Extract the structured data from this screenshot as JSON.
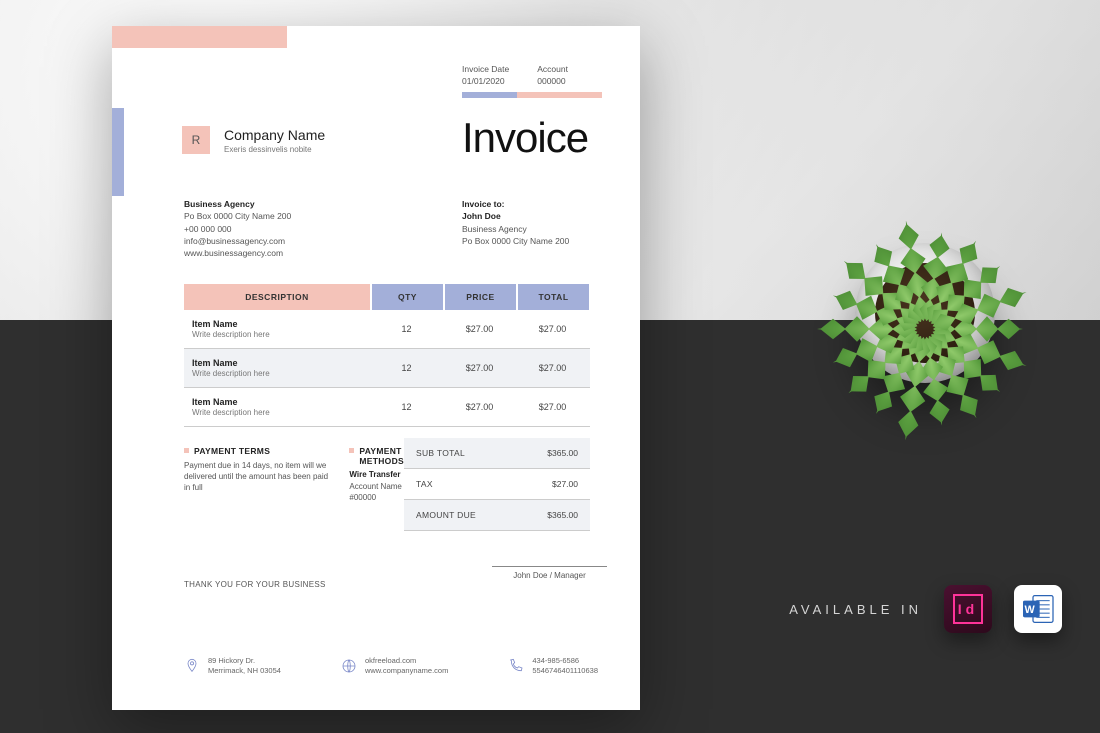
{
  "meta": {
    "date_label": "Invoice Date",
    "date_value": "01/01/2020",
    "account_label": "Account",
    "account_value": "000000"
  },
  "logo_letter": "R",
  "company": {
    "name": "Company Name",
    "tagline": "Exeris dessinvelis nobite"
  },
  "title": "Invoice",
  "from": {
    "name": "Business Agency",
    "line1": "Po Box 0000 City Name 200",
    "phone": "+00 000 000",
    "email": "info@businessagency.com",
    "web": "www.businessagency.com"
  },
  "to": {
    "label": "Invoice to:",
    "name": "John Doe",
    "company": "Business Agency",
    "address": "Po Box 0000 City Name 200"
  },
  "table": {
    "headers": {
      "desc": "DESCRIPTION",
      "qty": "QTY",
      "price": "PRICE",
      "total": "TOTAL"
    },
    "rows": [
      {
        "name": "Item Name",
        "desc": "Write description here",
        "qty": "12",
        "price": "$27.00",
        "total": "$27.00"
      },
      {
        "name": "Item Name",
        "desc": "Write description here",
        "qty": "12",
        "price": "$27.00",
        "total": "$27.00"
      },
      {
        "name": "Item Name",
        "desc": "Write description here",
        "qty": "12",
        "price": "$27.00",
        "total": "$27.00"
      }
    ]
  },
  "payment_terms": {
    "heading": "PAYMENT TERMS",
    "body": "Payment due in 14 days, no item will we delivered until the amount has been paid in full"
  },
  "payment_methods": {
    "heading": "PAYMENT METHODS",
    "sub": "Wire Transfer",
    "line1": "Account Name",
    "line2": "#00000"
  },
  "totals": {
    "subtotal_label": "SUB TOTAL",
    "subtotal_value": "$365.00",
    "tax_label": "TAX",
    "tax_value": "$27.00",
    "due_label": "AMOUNT DUE",
    "due_value": "$365.00"
  },
  "thanks": "THANK YOU FOR YOUR BUSINESS",
  "signature": "John Doe / Manager",
  "footer": {
    "addr1": "89 Hickory Dr.",
    "addr2": "Merrimack, NH 03054",
    "web1": "okfreeload.com",
    "web2": "www.companyname.com",
    "ph1": "434-985-6586",
    "ph2": "5546746401110638"
  },
  "available_label": "AVAILABLE IN",
  "badges": {
    "id": "Id",
    "word": "W"
  },
  "colors": {
    "pink": "#f4c3b9",
    "blue": "#a3afd9",
    "dark": "#2f2f2f"
  }
}
